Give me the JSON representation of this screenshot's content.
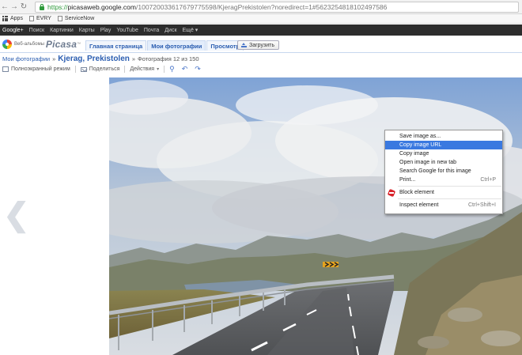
{
  "browser": {
    "url_scheme": "https://",
    "url_host": "picasaweb.google.com",
    "url_path": "/100720033617679775598/KjeragPrekistolen?noredirect=1#5623254818102497586",
    "bookmarks": [
      {
        "label": "Apps",
        "icon": "apps-grid-icon"
      },
      {
        "label": "EVRY",
        "icon": "page-icon"
      },
      {
        "label": "ServiceNow",
        "icon": "page-icon"
      }
    ]
  },
  "google_bar": {
    "items": [
      "Google+",
      "Поиск",
      "Картинки",
      "Карты",
      "Play",
      "YouTube",
      "Почта",
      "Диск",
      "Ещё ▾"
    ]
  },
  "picasa": {
    "logo_small": "Веб-альбомы",
    "logo_name": "Picasa",
    "logo_tm": "™",
    "tabs": [
      {
        "label": "Главная страница",
        "active": false
      },
      {
        "label": "Мои фотографии",
        "active": true
      },
      {
        "label": "Просмотр",
        "active": false
      }
    ],
    "upload_label": "Загрузить"
  },
  "breadcrumb": {
    "root": "Мои фотографии",
    "sep": "»",
    "album": "Kjerag, Prekistolen",
    "count_text": "Фотография 12 из 150"
  },
  "toolbar": {
    "fullscreen": "Полноэкранный режим",
    "share": "Поделиться",
    "actions": "Действия",
    "caret": "▾",
    "zoom_glyph": "⚲",
    "rotate_left_glyph": "↶",
    "rotate_right_glyph": "↷"
  },
  "viewer": {
    "prev_glyph": "❮"
  },
  "context_menu": {
    "items": [
      {
        "label": "Save image as...",
        "shortcut": "",
        "highlighted": false
      },
      {
        "label": "Copy image URL",
        "shortcut": "",
        "highlighted": true
      },
      {
        "label": "Copy image",
        "shortcut": "",
        "highlighted": false
      },
      {
        "label": "Open image in new tab",
        "shortcut": "",
        "highlighted": false
      },
      {
        "label": "Search Google for this image",
        "shortcut": "",
        "highlighted": false
      },
      {
        "label": "Print...",
        "shortcut": "Ctrl+P",
        "highlighted": false
      },
      {
        "label": "Block element",
        "shortcut": "",
        "highlighted": false
      },
      {
        "label": "Inspect element",
        "shortcut": "Ctrl+Shift+I",
        "highlighted": false
      }
    ]
  },
  "colors": {
    "link_blue": "#2a5db0",
    "menu_highlight": "#3a79e0",
    "gbar": "#2d2d2d",
    "secure_green": "#2e9a3b",
    "block_red": "#d8232a"
  }
}
